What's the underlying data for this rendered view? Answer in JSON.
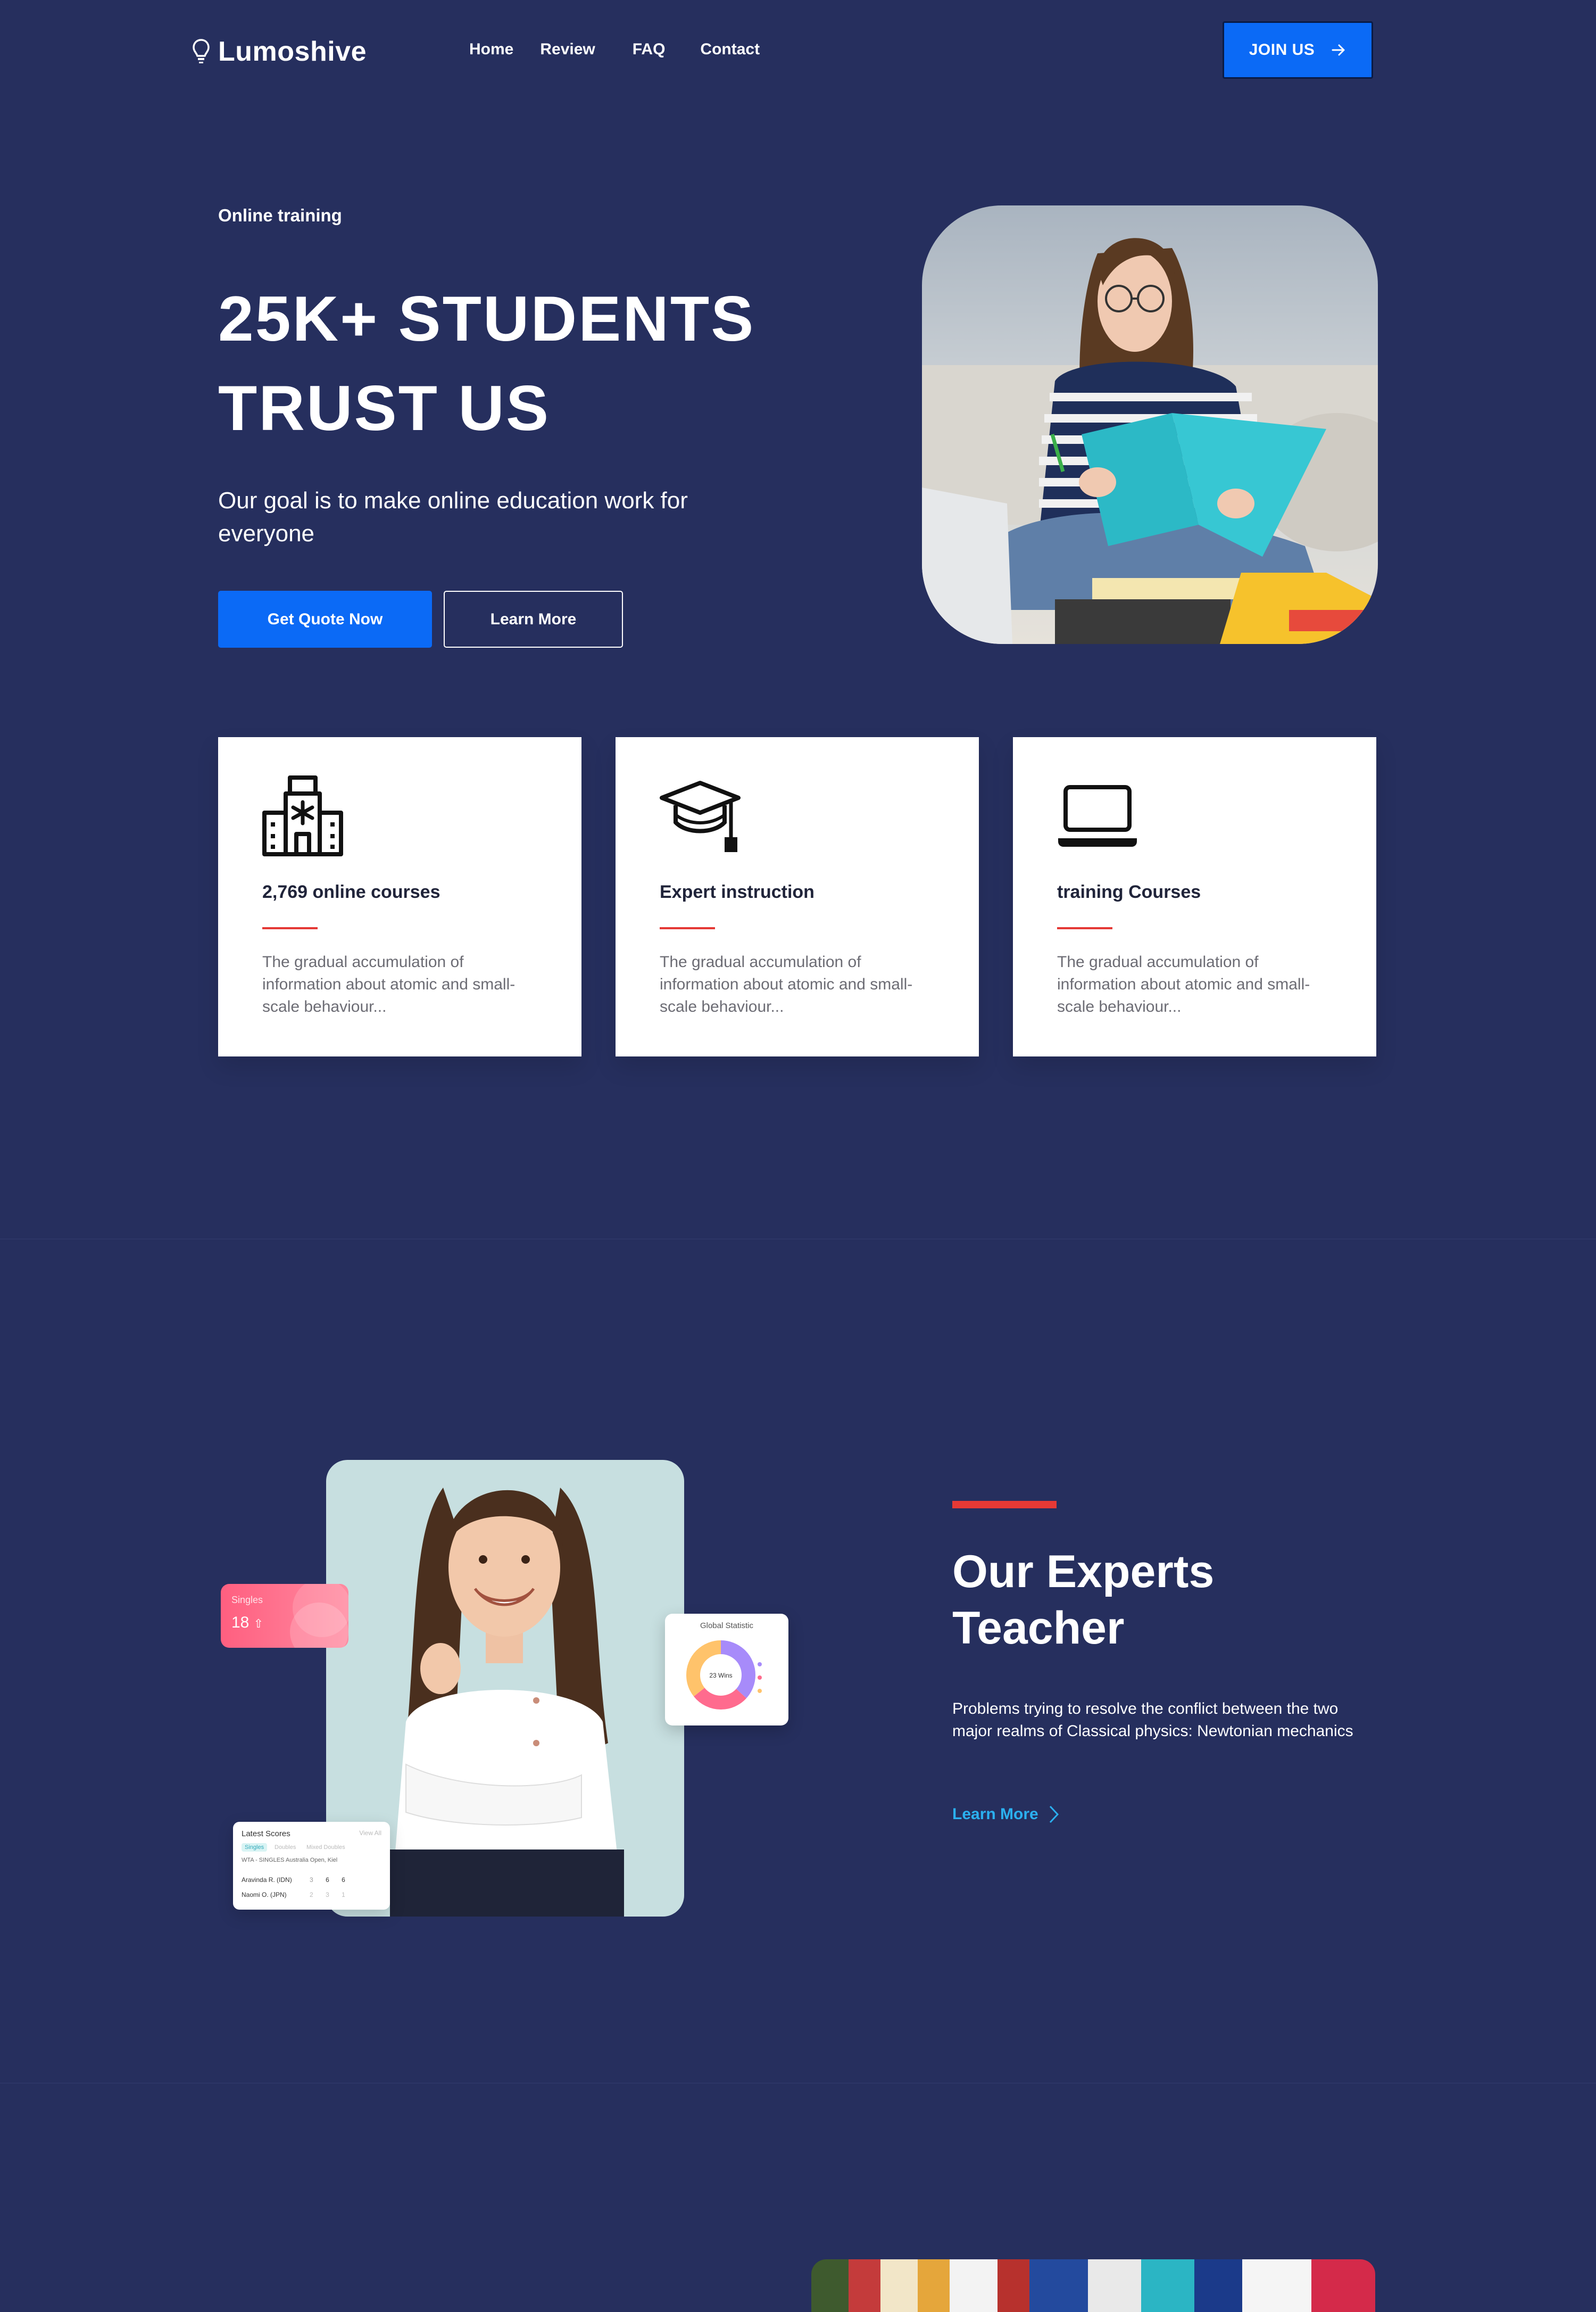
{
  "header": {
    "brand": "Lumoshive",
    "nav": [
      "Home",
      "Review",
      "FAQ",
      "Contact"
    ],
    "join_label": "JOIN US"
  },
  "hero": {
    "eyebrow": "Online training",
    "title_line1": "25K+ STUDENTS",
    "title_line2": "TRUST US",
    "subtitle": "Our goal is to make online education work for everyone",
    "primary_cta": "Get Quote Now",
    "secondary_cta": "Learn More"
  },
  "features": [
    {
      "icon": "building-icon",
      "title": "2,769 online courses",
      "desc": "The gradual accumulation of information about atomic and small-scale behaviour..."
    },
    {
      "icon": "graduation-cap-icon",
      "title": "Expert instruction",
      "desc": "The gradual accumulation of information about atomic and small-scale behaviour..."
    },
    {
      "icon": "laptop-icon",
      "title": "training Courses",
      "desc": "The gradual accumulation of information about atomic and small-scale behaviour..."
    }
  ],
  "experts": {
    "title": "Our Experts Teacher",
    "description": "Problems trying to resolve the conflict between the two major realms of Classical physics: Newtonian mechanics",
    "link": "Learn More",
    "singles_card": {
      "label": "Singles",
      "value": "18"
    },
    "stat_card": {
      "label": "Global Statistic",
      "center": "23 Wins"
    },
    "scores_card": {
      "title": "Latest Scores",
      "view": "View All",
      "tabs": [
        "Singles",
        "Doubles",
        "Mixed Doubles"
      ],
      "event": "WTA - SINGLES Australia Open, Kiel",
      "rows": [
        {
          "name": "Aravinda R. (IDN)",
          "scores": [
            "3",
            "6",
            "6"
          ]
        },
        {
          "name": "Naomi O. (JPN)",
          "scores": [
            "2",
            "3",
            "1"
          ]
        }
      ]
    }
  },
  "colors": {
    "background": "#262f5e",
    "primary": "#0b6af6",
    "accent_red": "#e53935",
    "link": "#2bb0f0"
  }
}
